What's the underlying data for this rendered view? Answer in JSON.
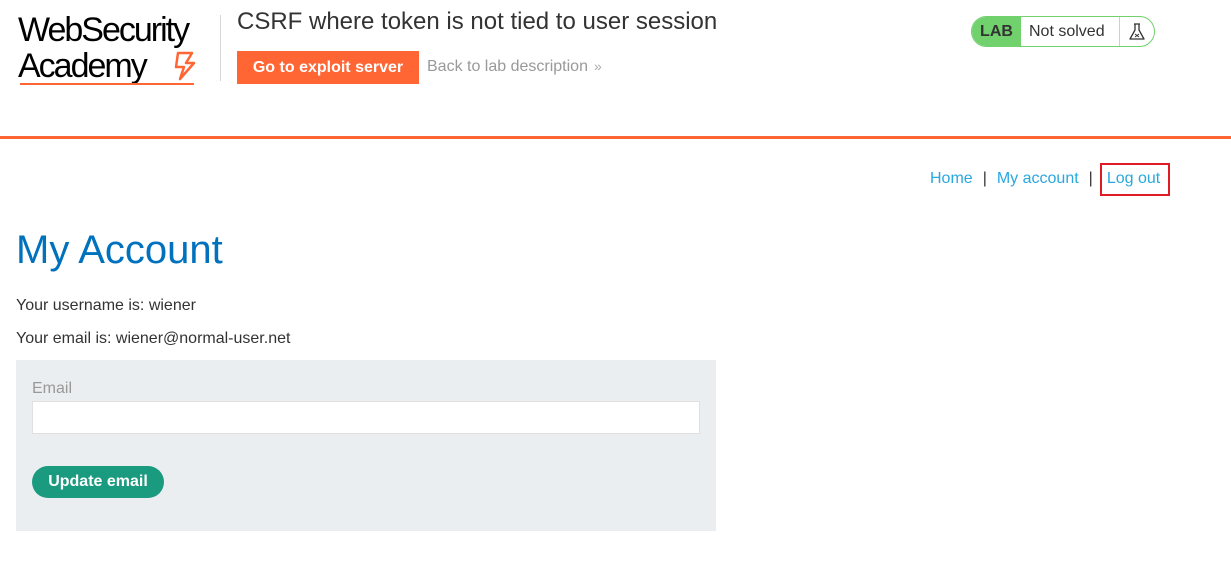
{
  "logo": {
    "line1": "WebSecurity",
    "line2": "Academy"
  },
  "lab": {
    "title": "CSRF where token is not tied to user session",
    "exploit_button": "Go to exploit server",
    "back_link": "Back to lab description",
    "badge": "LAB",
    "status": "Not solved"
  },
  "nav": {
    "home": "Home",
    "separator": "|",
    "my_account": "My account",
    "logout": "Log out"
  },
  "page": {
    "heading": "My Account",
    "username_line": "Your username is: wiener",
    "email_line": "Your email is: wiener@normal-user.net"
  },
  "form": {
    "email_label": "Email",
    "email_value": "",
    "submit_label": "Update email"
  },
  "colors": {
    "accent": "#ff6633",
    "link": "#29a8de",
    "heading": "#0071bc",
    "button": "#1a9a7f",
    "lab_green": "#70d16d",
    "highlight": "#e01b24"
  }
}
